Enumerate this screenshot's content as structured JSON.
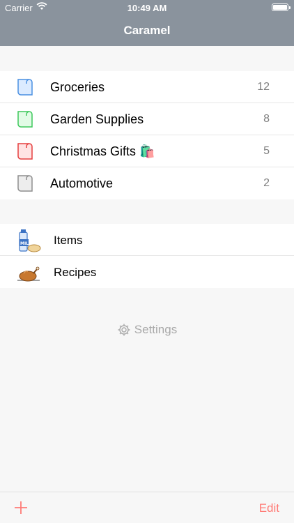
{
  "status_bar": {
    "carrier": "Carrier",
    "time": "10:49 AM"
  },
  "nav": {
    "title": "Caramel"
  },
  "lists": [
    {
      "name": "Groceries",
      "count": "12",
      "color": "#4a90e2",
      "fill": "#dcebff"
    },
    {
      "name": "Garden Supplies",
      "count": "8",
      "color": "#3cc85a",
      "fill": "#e2fbe6"
    },
    {
      "name": "Christmas Gifts 🛍️",
      "count": "5",
      "color": "#e53e3e",
      "fill": "#ffe3e3"
    },
    {
      "name": "Automotive",
      "count": "2",
      "color": "#8e8e8e",
      "fill": "#ededed"
    }
  ],
  "tools": [
    {
      "name": "Items",
      "icon": "milk-bread-icon"
    },
    {
      "name": "Recipes",
      "icon": "roast-turkey-icon"
    }
  ],
  "settings": {
    "label": "Settings",
    "icon": "gear-icon"
  },
  "bottom_bar": {
    "add_icon": "plus-icon",
    "edit_label": "Edit",
    "accent": "#ff7b76"
  }
}
